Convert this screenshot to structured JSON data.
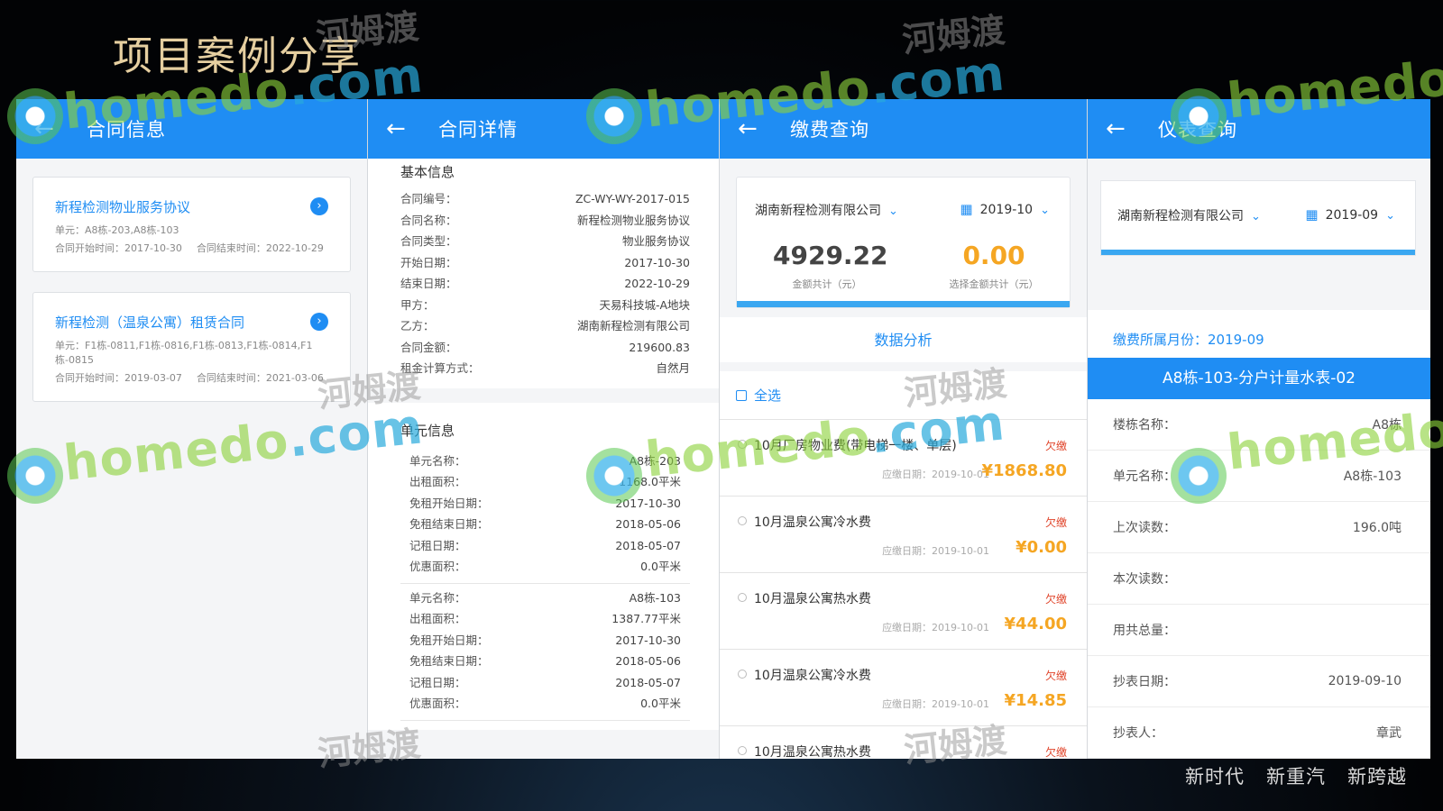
{
  "slide": {
    "title": "项目案例分享",
    "footer": [
      "新时代",
      "新重汽",
      "新跨越"
    ]
  },
  "watermark": {
    "brand": "homedo",
    "domain": ".com",
    "chinese": "河姆渡"
  },
  "screen1": {
    "back_icon": "←",
    "title": "合同信息",
    "cards": [
      {
        "title": "新程检测物业服务协议",
        "go_icon": "›",
        "unit": "单元：A8栋-203,A8栋-103",
        "start": "合同开始时间：2017-10-30",
        "end": "合同结束时间：2022-10-29"
      },
      {
        "title": "新程检测（温泉公寓）租赁合同",
        "go_icon": "›",
        "unit": "单元：F1栋-0811,F1栋-0816,F1栋-0813,F1栋-0814,F1栋-0815",
        "start": "合同开始时间：2019-03-07",
        "end": "合同结束时间：2021-03-06"
      }
    ]
  },
  "screen2": {
    "back_icon": "←",
    "title": "合同详情",
    "basic_title": "基本信息",
    "basic": [
      {
        "k": "合同编号：",
        "v": "ZC-WY-WY-2017-015"
      },
      {
        "k": "合同名称：",
        "v": "新程检测物业服务协议"
      },
      {
        "k": "合同类型：",
        "v": "物业服务协议"
      },
      {
        "k": "开始日期：",
        "v": "2017-10-30"
      },
      {
        "k": "结束日期：",
        "v": "2022-10-29"
      },
      {
        "k": "甲方：",
        "v": "天易科技城-A地块"
      },
      {
        "k": "乙方：",
        "v": "湖南新程检测有限公司"
      },
      {
        "k": "合同金额：",
        "v": "219600.83"
      },
      {
        "k": "租金计算方式：",
        "v": "自然月"
      }
    ],
    "unit_title": "单元信息",
    "units": [
      [
        {
          "k": "单元名称：",
          "v": "A8栋-203"
        },
        {
          "k": "出租面积：",
          "v": "1168.0平米"
        },
        {
          "k": "免租开始日期：",
          "v": "2017-10-30"
        },
        {
          "k": "免租结束日期：",
          "v": "2018-05-06"
        },
        {
          "k": "记租日期：",
          "v": "2018-05-07"
        },
        {
          "k": "优惠面积：",
          "v": "0.0平米"
        }
      ],
      [
        {
          "k": "单元名称：",
          "v": "A8栋-103"
        },
        {
          "k": "出租面积：",
          "v": "1387.77平米"
        },
        {
          "k": "免租开始日期：",
          "v": "2017-10-30"
        },
        {
          "k": "免租结束日期：",
          "v": "2018-05-06"
        },
        {
          "k": "记租日期：",
          "v": "2018-05-07"
        },
        {
          "k": "优惠面积：",
          "v": "0.0平米"
        }
      ]
    ]
  },
  "screen3": {
    "back_icon": "←",
    "title": "缴费查询",
    "company": "湖南新程检测有限公司",
    "date": "2019-10",
    "chevron": "⌄",
    "total_amount": "4929.22",
    "total_caption": "金额共计（元）",
    "selected_amount": "0.00",
    "selected_caption": "选择金额共计（元）",
    "analysis_link": "数据分析",
    "select_all": "全选",
    "fees": [
      {
        "name": "10月厂房物业费(带电梯一楼、单层)",
        "status": "欠缴",
        "due": "应缴日期：2019-10-01",
        "amount": "¥1868.80"
      },
      {
        "name": "10月温泉公寓冷水费",
        "status": "欠缴",
        "due": "应缴日期：2019-10-01",
        "amount": "¥0.00"
      },
      {
        "name": "10月温泉公寓热水费",
        "status": "欠缴",
        "due": "应缴日期：2019-10-01",
        "amount": "¥44.00"
      },
      {
        "name": "10月温泉公寓冷水费",
        "status": "欠缴",
        "due": "应缴日期：2019-10-01",
        "amount": "¥14.85"
      },
      {
        "name": "10月温泉公寓热水费",
        "status": "欠缴",
        "due": "",
        "amount": ""
      }
    ]
  },
  "screen4": {
    "back_icon": "←",
    "title": "仪表查询",
    "company": "湖南新程检测有限公司",
    "date": "2019-09",
    "chevron": "⌄",
    "month_label": "缴费所属月份：2019-09",
    "meter_name": "A8栋-103-分户计量水表-02",
    "rows": [
      {
        "k": "楼栋名称：",
        "v": "A8栋"
      },
      {
        "k": "单元名称：",
        "v": "A8栋-103"
      },
      {
        "k": "上次读数：",
        "v": "196.0吨"
      },
      {
        "k": "本次读数：",
        "v": ""
      },
      {
        "k": "用共总量：",
        "v": ""
      },
      {
        "k": "抄表日期：",
        "v": "2019-09-10"
      },
      {
        "k": "抄表人：",
        "v": "章武"
      }
    ]
  },
  "colors": {
    "primary": "#1f8df3",
    "amount": "#f5a623",
    "overdue": "#e0452b",
    "title_gold": "#e6cfa0"
  }
}
